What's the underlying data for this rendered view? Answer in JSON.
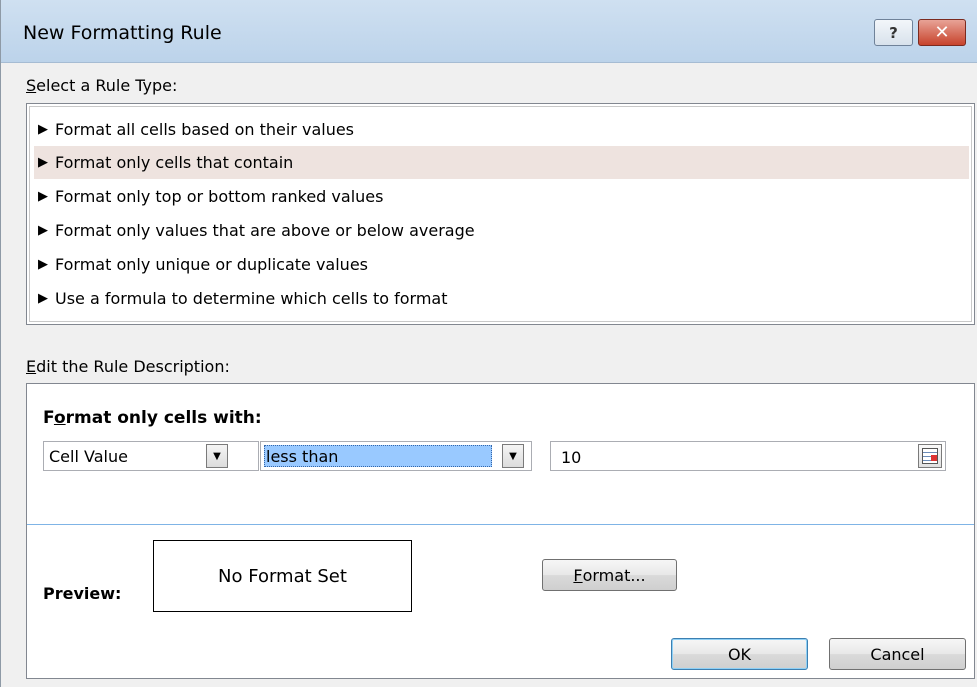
{
  "window": {
    "title": "New Formatting Rule",
    "help_glyph": "?",
    "close_glyph": "✕"
  },
  "rule_type": {
    "label_mnemonic": "S",
    "label_rest": "elect a Rule Type:",
    "items": [
      {
        "label": "Format all cells based on their values",
        "selected": false
      },
      {
        "label": "Format only cells that contain",
        "selected": true
      },
      {
        "label": "Format only top or bottom ranked values",
        "selected": false
      },
      {
        "label": "Format only values that are above or below average",
        "selected": false
      },
      {
        "label": "Format only unique or duplicate values",
        "selected": false
      },
      {
        "label": "Use a formula to determine which cells to format",
        "selected": false
      }
    ]
  },
  "description": {
    "label_mnemonic": "E",
    "label_rest": "dit the Rule Description:",
    "heading_pre": "F",
    "heading_mnemonic": "o",
    "heading_rest": "rmat only cells with:",
    "condition_type": "Cell Value",
    "operator": "less than",
    "value": "10",
    "preview_label": "Preview:",
    "preview_text": "No Format Set",
    "format_button_mnemonic": "F",
    "format_button_rest": "ormat..."
  },
  "buttons": {
    "ok": "OK",
    "cancel": "Cancel"
  },
  "colors": {
    "selected_row": "#eee3df",
    "operator_highlight": "#99c9ff",
    "divider": "#7fb4e6"
  }
}
